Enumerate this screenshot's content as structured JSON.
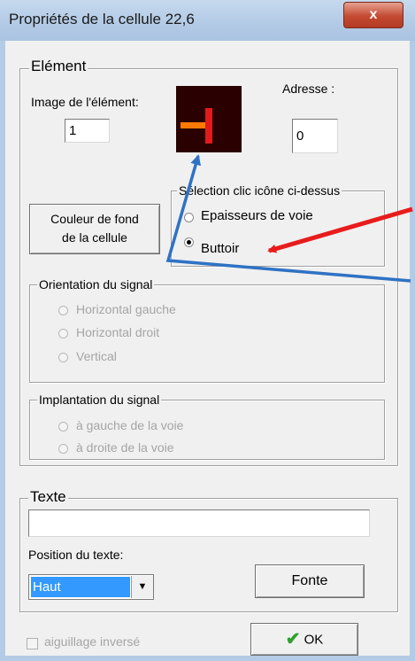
{
  "window": {
    "title": "Propriétés de la cellule 22,6",
    "close_label": "x"
  },
  "element_group": {
    "legend": "Elément",
    "image_label": "Image de l'élément:",
    "image_value": "1",
    "address_label": "Adresse :",
    "address_value": "0",
    "bg_color_button_line1": "Couleur de fond",
    "bg_color_button_line2": "de la cellule"
  },
  "selection_group": {
    "legend": "Sélection clic icône ci-dessus",
    "options": [
      "Epaisseurs de voie",
      "Buttoir"
    ],
    "selected": "Buttoir"
  },
  "orientation_group": {
    "legend": "Orientation du signal",
    "options": [
      "Horizontal gauche",
      "Horizontal droit",
      "Vertical"
    ]
  },
  "implantation_group": {
    "legend": "Implantation du signal",
    "options": [
      "à gauche de la voie",
      "à droite de la voie"
    ]
  },
  "text_group": {
    "legend": "Texte",
    "text_value": "",
    "position_label": "Position du texte:",
    "position_value": "Haut",
    "font_button": "Fonte"
  },
  "footer": {
    "checkbox_label": "aiguillage inversé",
    "ok_label": "OK"
  },
  "colors": {
    "preview_bg": "#2a0000",
    "track_orange": "#ff7a00",
    "buffer_red": "#e11b1b",
    "annotation_red": "#e81c1c",
    "annotation_blue": "#2f72c4",
    "ok_check_green": "#2ea12e"
  }
}
